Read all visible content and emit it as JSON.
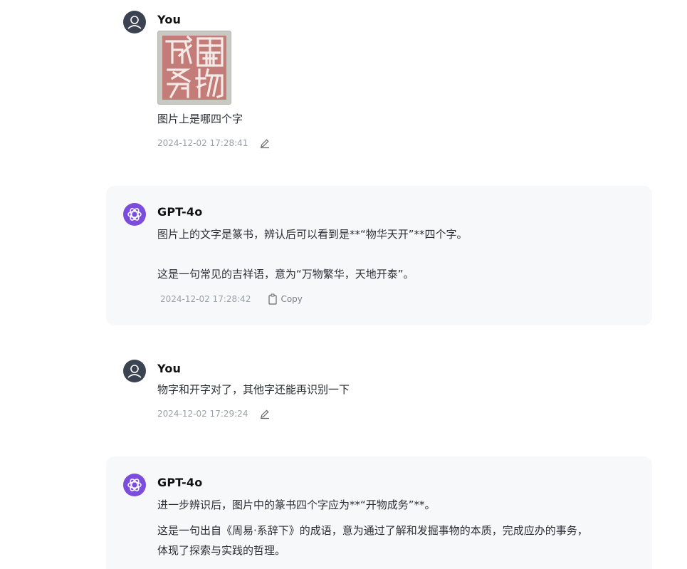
{
  "messages": [
    {
      "role": "user",
      "name": "You",
      "text": "图片上是哪四个字",
      "timestamp": "2024-12-02 17:28:41",
      "image_alt": "篆书印章 開物成務"
    },
    {
      "role": "assistant",
      "name": "GPT-4o",
      "paragraphs": [
        "图片上的文字是篆书，辨认后可以看到是**“物华天开”**四个字。",
        "这是一句常见的吉祥语，意为“万物繁华，天地开泰”。"
      ],
      "timestamp": "2024-12-02 17:28:42",
      "copy_label": "Copy"
    },
    {
      "role": "user",
      "name": "You",
      "text": "物字和开字对了，其他字还能再识别一下",
      "timestamp": "2024-12-02 17:29:24"
    },
    {
      "role": "assistant",
      "name": "GPT-4o",
      "paragraphs": [
        "进一步辨识后，图片中的篆书四个字应为**“开物成务”**。",
        "这是一句出自《周易·系辞下》的成语，意为通过了解和发掘事物的本质，完成应办的事务，",
        "体现了探索与实践的哲理。"
      ]
    }
  ],
  "colors": {
    "user_avatar": "#3b4252",
    "assistant_avatar": "#7c4ddc",
    "assistant_bubble": "#f7f8fa",
    "seal_red": "#c47c78"
  },
  "icons": {
    "user_avatar": "user-icon",
    "assistant_avatar": "openai-icon",
    "edit": "pencil-icon",
    "copy": "clipboard-icon"
  }
}
